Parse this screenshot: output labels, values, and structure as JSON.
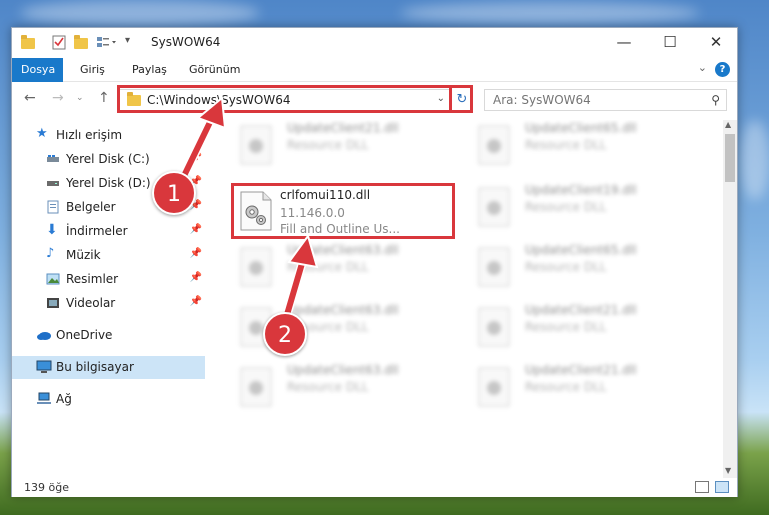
{
  "window": {
    "title": "SysWOW64"
  },
  "ribbon": {
    "tabs": [
      {
        "label": "Dosya",
        "active": true
      },
      {
        "label": "Giriş",
        "active": false
      },
      {
        "label": "Paylaş",
        "active": false
      },
      {
        "label": "Görünüm",
        "active": false
      }
    ],
    "help": "?"
  },
  "navbar": {
    "address": "C:\\Windows\\SysWOW64",
    "search_placeholder": "Ara: SysWOW64"
  },
  "sidebar": {
    "items": [
      {
        "label": "Hızlı erişim",
        "icon": "star-icon"
      },
      {
        "label": "Yerel Disk (C:)",
        "icon": "drive-icon",
        "pinned": true
      },
      {
        "label": "Yerel Disk (D:)",
        "icon": "drive-icon",
        "pinned": true
      },
      {
        "label": "Belgeler",
        "icon": "document-icon",
        "pinned": true
      },
      {
        "label": "İndirmeler",
        "icon": "download-icon",
        "pinned": true
      },
      {
        "label": "Müzik",
        "icon": "music-icon",
        "pinned": true
      },
      {
        "label": "Resimler",
        "icon": "pictures-icon",
        "pinned": true
      },
      {
        "label": "Videolar",
        "icon": "video-icon",
        "pinned": true
      },
      {
        "label": "OneDrive",
        "icon": "cloud-icon"
      },
      {
        "label": "Bu bilgisayar",
        "icon": "computer-icon",
        "selected": true
      },
      {
        "label": "Ağ",
        "icon": "network-icon"
      }
    ]
  },
  "files": [
    {
      "name": "UpdateClient21.dll",
      "desc": "Resource DLL"
    },
    {
      "name": "UpdateClient65.dll",
      "desc": "Resource DLL"
    },
    {
      "name": "UpdateClient19.dll",
      "desc": "Resource DLL"
    },
    {
      "name": "UpdateClient63.dll",
      "desc": "Resource DLL"
    },
    {
      "name": "UpdateClient65.dll",
      "desc": "Resource DLL"
    },
    {
      "name": "UpdateClient63.dll",
      "desc": "Resource DLL"
    },
    {
      "name": "UpdateClient21.dll",
      "desc": "Resource DLL"
    },
    {
      "name": "UpdateClient63.dll",
      "desc": "Resource DLL"
    },
    {
      "name": "UpdateClient21.dll",
      "desc": "Resource DLL"
    }
  ],
  "featured_file": {
    "name": "crlfomui110.dll",
    "version": "11.146.0.0",
    "description": "Fill and Outline Us..."
  },
  "status": {
    "count": "139 öğe"
  },
  "annotations": {
    "step1": "1",
    "step2": "2",
    "color": "#d9373c"
  }
}
